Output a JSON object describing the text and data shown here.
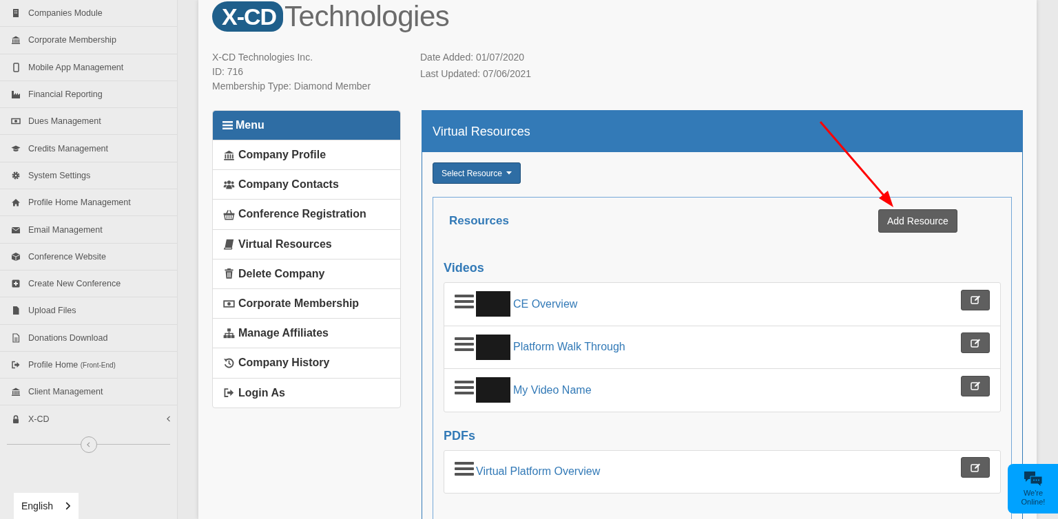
{
  "sidebar": {
    "items": [
      {
        "label": "Companies Module",
        "kind": "link"
      },
      {
        "label": "Corporate Membership",
        "kind": "link"
      },
      {
        "label": "Mobile App Management",
        "kind": "link"
      },
      {
        "label": "Financial Reporting",
        "kind": "link"
      },
      {
        "label": "Dues Management",
        "kind": "link"
      },
      {
        "label": "Credits Management",
        "kind": "link"
      },
      {
        "label": "System Settings",
        "kind": "link"
      },
      {
        "label": "Profile Home Management",
        "kind": "link"
      },
      {
        "label": "Email Management",
        "kind": "link"
      },
      {
        "label": "Conference Website",
        "kind": "link"
      },
      {
        "label": "Create New Conference",
        "kind": "link"
      },
      {
        "label": "Upload Files",
        "kind": "link"
      },
      {
        "label": "Donations Download",
        "kind": "link"
      },
      {
        "label": "Profile Home",
        "note": "(Front-End)",
        "kind": "link"
      },
      {
        "label": "Client Management",
        "kind": "link"
      },
      {
        "label": "X-CD",
        "kind": "group"
      }
    ]
  },
  "language": {
    "label": "English"
  },
  "logo": {
    "mark": "X-CD",
    "wordmark": "Technologies"
  },
  "company": {
    "name": "X-CD Technologies Inc.",
    "id": "ID: 716",
    "membership": "Membership Type: Diamond Member",
    "date_added": "Date Added: 01/07/2020",
    "last_updated": "Last Updated: 07/06/2021"
  },
  "menu": {
    "title": "Menu",
    "items": [
      {
        "label": "Company Profile"
      },
      {
        "label": "Company Contacts"
      },
      {
        "label": "Conference Registration"
      },
      {
        "label": "Virtual Resources"
      },
      {
        "label": "Delete Company"
      },
      {
        "label": "Corporate Membership"
      },
      {
        "label": "Manage Affiliates"
      },
      {
        "label": "Company History"
      },
      {
        "label": "Login As"
      }
    ]
  },
  "panel": {
    "title": "Virtual Resources",
    "select_button": "Select Resource",
    "resources": {
      "title": "Resources",
      "add_button": "Add Resource",
      "sections": [
        {
          "title": "Videos",
          "items": [
            {
              "title": "CE Overview",
              "kind": "video"
            },
            {
              "title": "Platform Walk Through",
              "kind": "video"
            },
            {
              "title": "My Video Name",
              "kind": "video"
            }
          ]
        },
        {
          "title": "PDFs",
          "items": [
            {
              "title": "Virtual Platform Overview",
              "kind": "pdf"
            }
          ]
        }
      ]
    }
  },
  "chat": {
    "label": "We're Online!"
  }
}
